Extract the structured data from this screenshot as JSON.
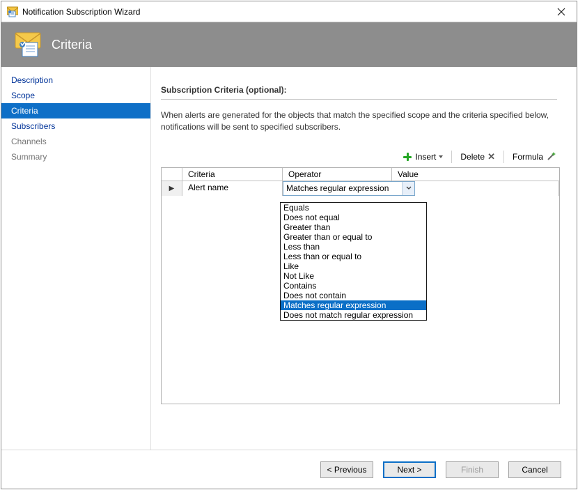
{
  "window": {
    "title": "Notification Subscription Wizard"
  },
  "banner": {
    "title": "Criteria"
  },
  "sidebar": {
    "items": [
      {
        "label": "Description",
        "state": "link"
      },
      {
        "label": "Scope",
        "state": "link"
      },
      {
        "label": "Criteria",
        "state": "selected"
      },
      {
        "label": "Subscribers",
        "state": "link"
      },
      {
        "label": "Channels",
        "state": "muted"
      },
      {
        "label": "Summary",
        "state": "muted"
      }
    ]
  },
  "section": {
    "heading": "Subscription Criteria (optional):",
    "helper": "When alerts are generated for the objects that match the specified scope and the criteria specified below, notifications will be sent to specified subscribers."
  },
  "toolbar": {
    "insert": "Insert",
    "delete": "Delete",
    "formula": "Formula"
  },
  "grid": {
    "columns": {
      "criteria": "Criteria",
      "operator": "Operator",
      "value": "Value"
    },
    "row0": {
      "criteria": "Alert name",
      "operator_display": "Matches regular expression"
    }
  },
  "operator_dropdown": {
    "items": [
      "Equals",
      "Does not equal",
      "Greater than",
      "Greater than or equal to",
      "Less than",
      "Less than or equal to",
      "Like",
      "Not Like",
      "Contains",
      "Does not contain",
      "Matches regular expression",
      "Does not match regular expression"
    ],
    "highlighted": "Matches regular expression"
  },
  "footer": {
    "previous": "< Previous",
    "next": "Next >",
    "finish": "Finish",
    "cancel": "Cancel"
  }
}
